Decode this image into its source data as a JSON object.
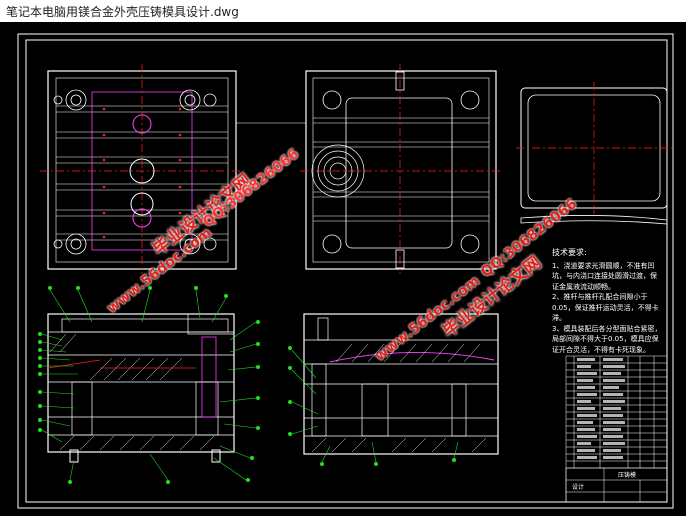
{
  "window": {
    "title": "笔记本电脑用镁合金外壳压铸模具设计.dwg"
  },
  "watermarks": {
    "site_cn_1": "毕业设计论文网",
    "qq_1": "QQ:306826066",
    "url_1": "www.56doc.com",
    "site_cn_2": "毕业设计论文网",
    "qq_2": "QQ:306826066",
    "url_2": "www.56doc.com",
    "site_cn_3": "毕业设计论文网",
    "qq_3": "QQ:306826066"
  },
  "tech_notes": {
    "heading": "技术要求:",
    "items": [
      "1、浇道要求光滑圆顺，不准有凹坑，与内浇口连接处圆滑过渡，保证金属液流动顺畅。",
      "2、推杆与推杆孔配合间隙小于0.05，保证推杆运动灵活，不得卡滞。",
      "3、模具装配后各分型面贴合紧密，局部间隙不得大于0.05，模具应保证开合灵活，不得有卡死现象。"
    ]
  },
  "title_block": {
    "label_a": "压铸模",
    "label_b": "设计"
  },
  "colors": {
    "drawing_bg": "#000000",
    "line_white": "#ffffff",
    "center_red": "#ff2020",
    "leader_green": "#22dd22",
    "part_magenta": "#ff40ff",
    "watermark_red": "#e0201b"
  }
}
